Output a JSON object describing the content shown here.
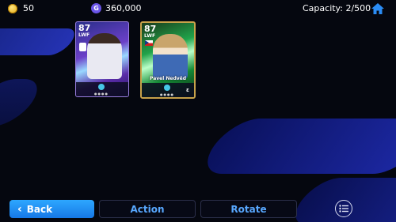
{
  "topbar": {
    "coins": "50",
    "gp_icon": "G",
    "gp": "360,000",
    "capacity": "Capacity: 2/500"
  },
  "cards": [
    {
      "rating": "87",
      "position": "LWF",
      "name": ""
    },
    {
      "rating": "87",
      "position": "LWF",
      "name": "Pavel Nedvěd"
    }
  ],
  "buttons": {
    "back": "Back",
    "action": "Action",
    "rotate": "Rotate"
  },
  "colors": {
    "accent": "#1f8ff2",
    "button_text": "#58a8ff",
    "background": "#05070f"
  },
  "icons": [
    "coin-icon",
    "gp-icon",
    "home-icon",
    "chevron-left-icon",
    "list-icon"
  ]
}
